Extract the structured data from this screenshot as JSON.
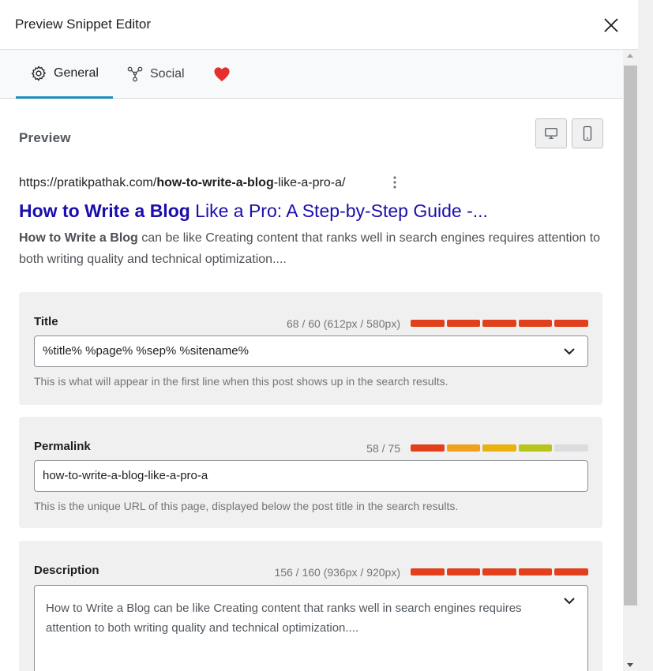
{
  "header": {
    "title": "Preview Snippet Editor"
  },
  "tabs": [
    {
      "label": "General",
      "icon": "gear-icon",
      "active": true
    },
    {
      "label": "Social",
      "icon": "share-icon",
      "active": false
    },
    {
      "label": "",
      "icon": "heart-icon",
      "active": false
    }
  ],
  "preview": {
    "label": "Preview",
    "url_prefix": "https://pratikpathak.com/",
    "url_bold": "how-to-write-a-blog",
    "url_suffix": "-like-a-pro-a/",
    "title_bold": "How to Write a Blog",
    "title_rest": " Like a Pro: A Step-by-Step Guide -...",
    "desc_bold": "How to Write a Blog",
    "desc_rest": " can be like Creating content that ranks well in search engines requires attention to both writing quality and technical optimization...."
  },
  "title_field": {
    "label": "Title",
    "count": "68 / 60 (612px / 580px)",
    "value": "%title% %page% %sep% %sitename%",
    "hint": "This is what will appear in the first line when this post shows up in the search results.",
    "meter_colors": [
      "#e2401c",
      "#e2401c",
      "#e2401c",
      "#e2401c",
      "#e2401c"
    ]
  },
  "permalink_field": {
    "label": "Permalink",
    "count": "58 / 75",
    "value": "how-to-write-a-blog-like-a-pro-a",
    "hint": "This is the unique URL of this page, displayed below the post title in the search results.",
    "meter_colors": [
      "#e2401c",
      "#f0a020",
      "#e9b20e",
      "#b8c41e",
      "#dcdcde"
    ]
  },
  "description_field": {
    "label": "Description",
    "count": "156 / 160 (936px / 920px)",
    "value": "How to Write a Blog can be like Creating content that ranks well in search engines requires attention to both writing quality and technical optimization....",
    "meter_colors": [
      "#e2401c",
      "#e2401c",
      "#e2401c",
      "#e2401c",
      "#e2401c"
    ]
  },
  "colors": {
    "accent": "#1e8cbe",
    "link": "#1a0dab",
    "heart": "#e62e2e"
  }
}
